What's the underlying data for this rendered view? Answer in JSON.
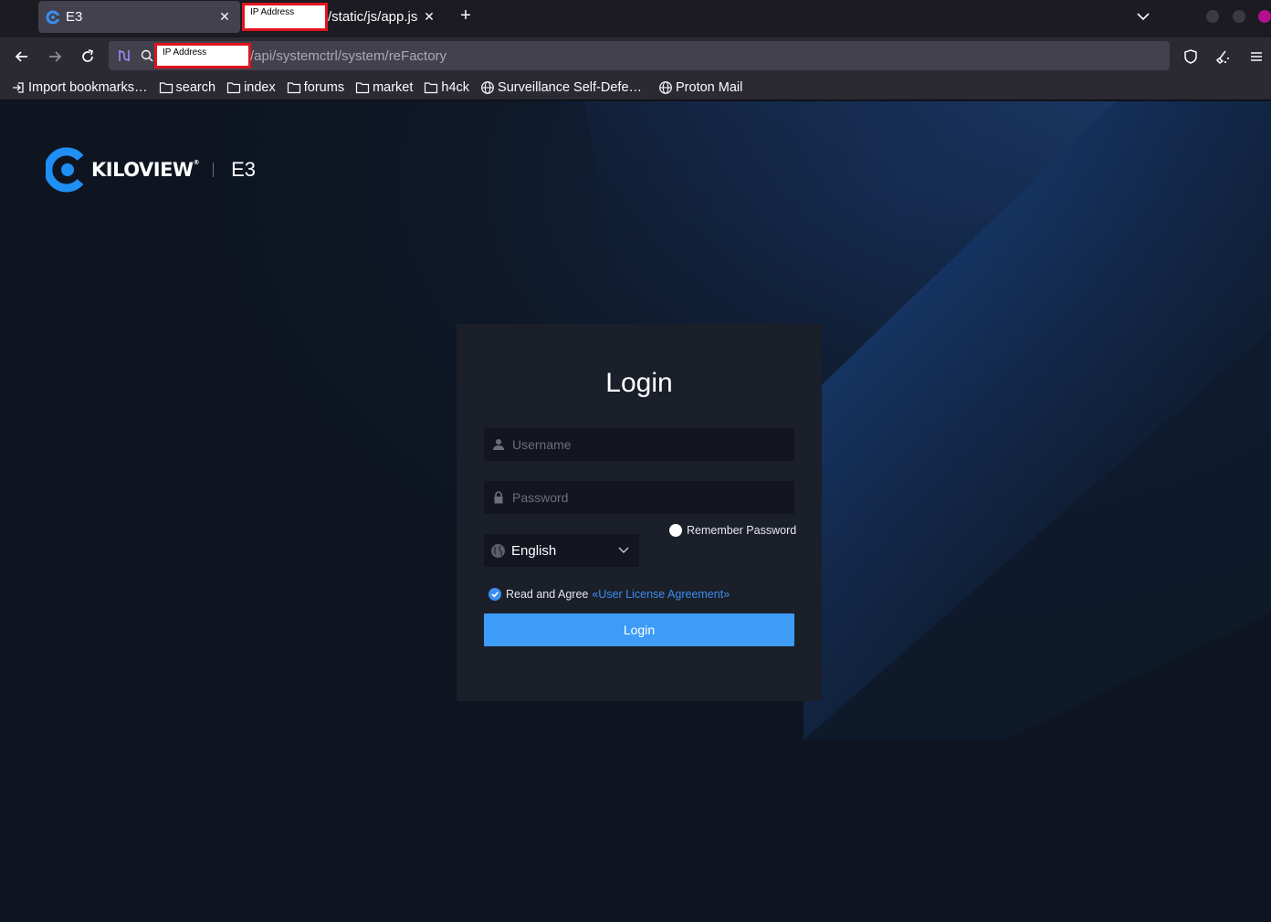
{
  "browser": {
    "tabs": [
      {
        "title": "E3"
      },
      {
        "redacted_label": "IP Address",
        "path": "/static/js/app.js"
      }
    ],
    "address_bar": {
      "redacted_label": "IP Address",
      "path": "/api/systemctrl/system/reFactory"
    },
    "bookmarks": [
      {
        "label": "Import bookmarks…",
        "icon": "import-icon"
      },
      {
        "label": "search",
        "icon": "folder-icon"
      },
      {
        "label": "index",
        "icon": "folder-icon"
      },
      {
        "label": "forums",
        "icon": "folder-icon"
      },
      {
        "label": "market",
        "icon": "folder-icon"
      },
      {
        "label": "h4ck",
        "icon": "folder-icon"
      },
      {
        "label": "Surveillance Self-Defe…",
        "icon": "globe-icon"
      },
      {
        "label": "Proton Mail",
        "icon": "globe-icon"
      }
    ]
  },
  "brand": {
    "logo_text": "KILOVIEW",
    "reg_mark": "®",
    "model": "E3"
  },
  "login": {
    "title": "Login",
    "username_placeholder": "Username",
    "password_placeholder": "Password",
    "remember_label": "Remember Password",
    "language": "English",
    "agree_text": "Read and Agree",
    "agreement_link": "«User License Agreement»",
    "button_label": "Login"
  },
  "colors": {
    "accent": "#3c9cf7",
    "card": "#1b1f29",
    "background": "#0e1521"
  }
}
